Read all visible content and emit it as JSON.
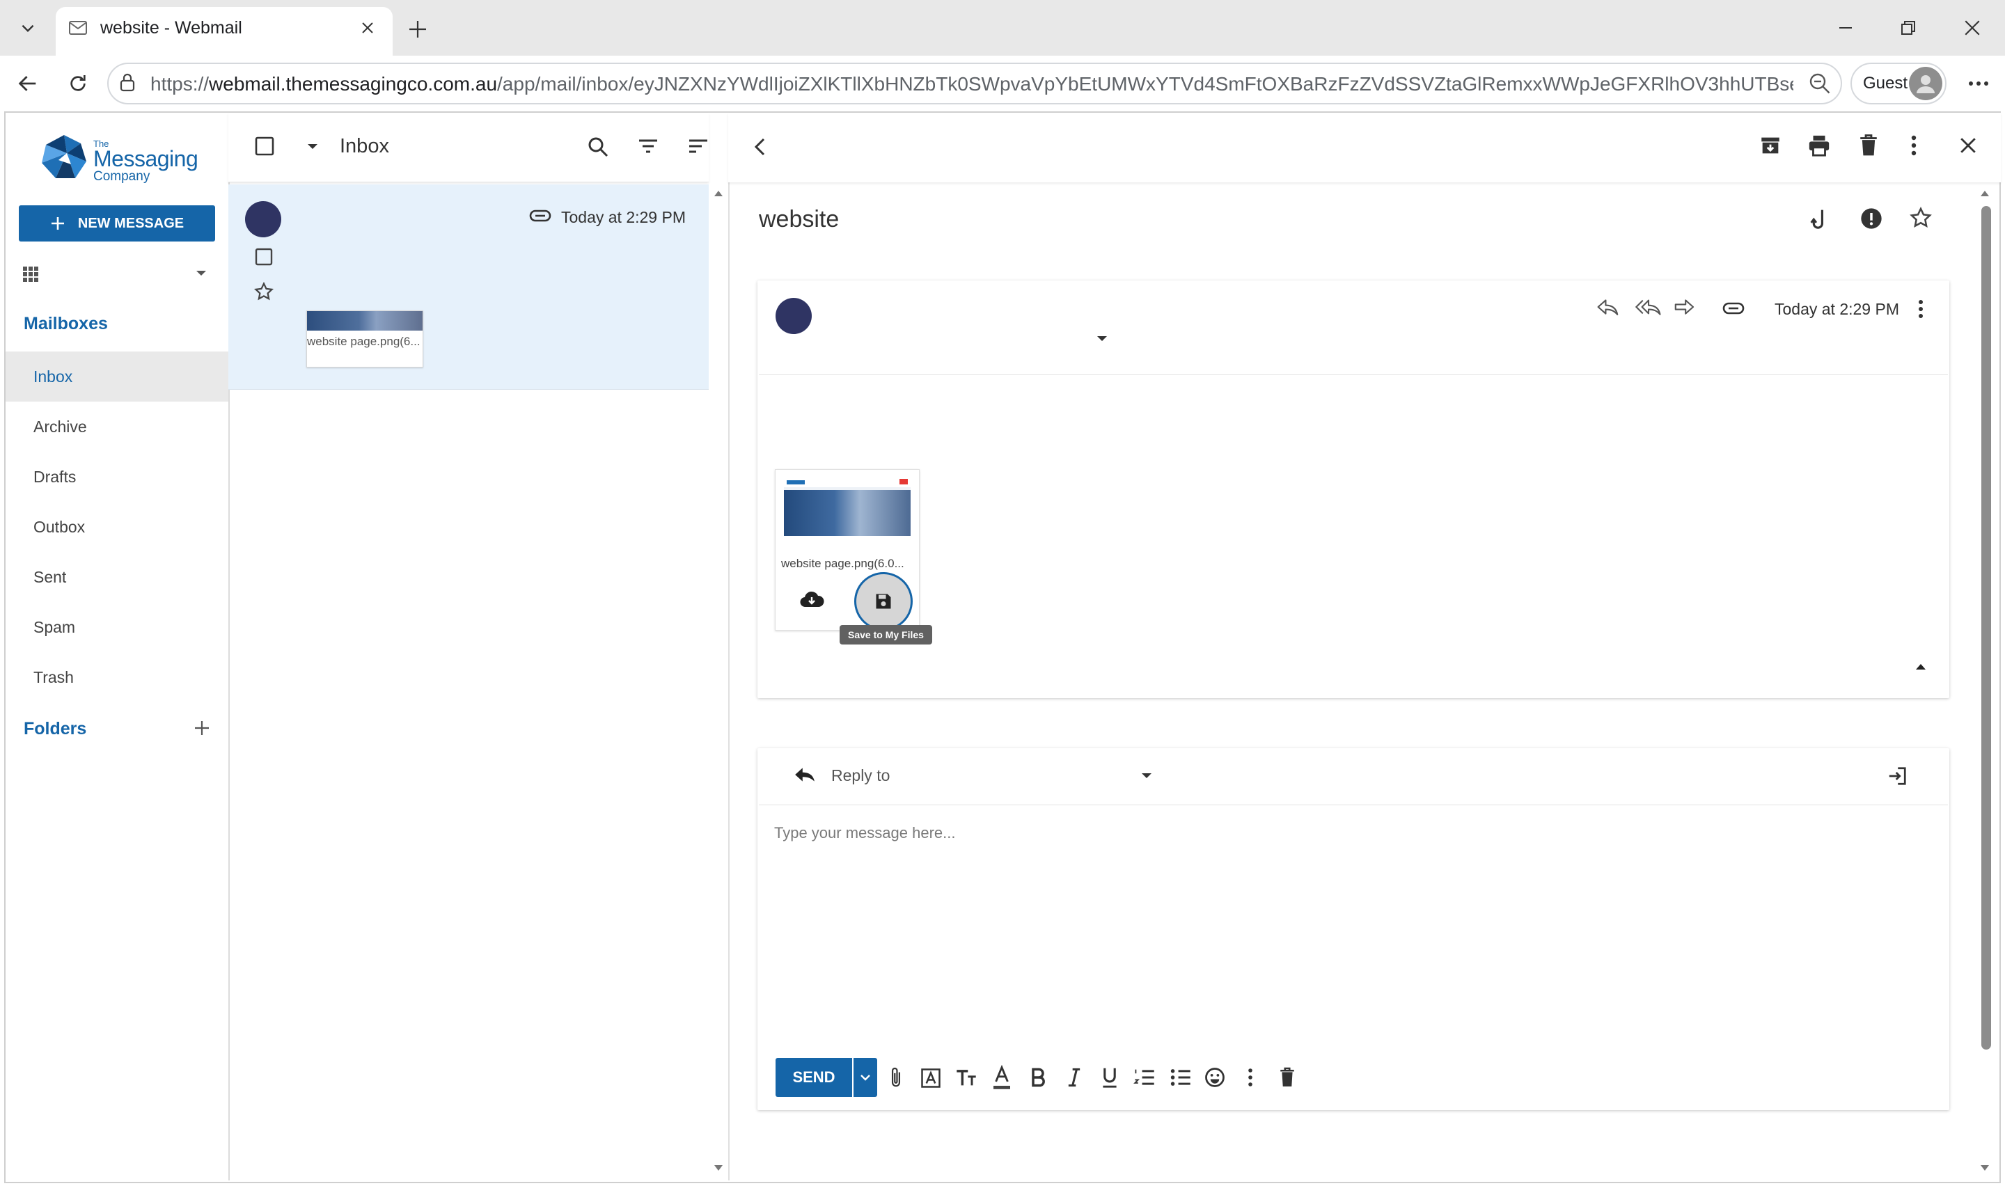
{
  "browser": {
    "tab_title": "website - Webmail",
    "url_prefix": "https://",
    "url_host": "webmail.themessagingco.com.au",
    "url_path": "/app/mail/inbox/eyJNZXNzYWdlIjoiZXlKTllXbHNZbTk0SWpvaVpYbEtUMWxYTVd4SmFtOXBaRzFzZVdSSVZtaGlRemxxWWpJeGFXRlhOV3hhUTBseINXd...",
    "profile_label": "Guest"
  },
  "brand": {
    "line1": "The",
    "line2": "Messaging",
    "line3": "Company"
  },
  "sidebar": {
    "new_message_label": "NEW MESSAGE",
    "mailboxes_heading": "Mailboxes",
    "items": [
      {
        "label": "Inbox",
        "active": true
      },
      {
        "label": "Archive"
      },
      {
        "label": "Drafts"
      },
      {
        "label": "Outbox"
      },
      {
        "label": "Sent"
      },
      {
        "label": "Spam"
      },
      {
        "label": "Trash"
      }
    ],
    "folders_heading": "Folders"
  },
  "list": {
    "title": "Inbox",
    "messages": [
      {
        "time": "Today at 2:29 PM",
        "attachment_name": "website page.png(6..."
      }
    ]
  },
  "reader": {
    "subject": "website",
    "time": "Today at 2:29 PM",
    "attachment_name": "website page.png(6.0...",
    "tooltip": "Save to My Files"
  },
  "reply": {
    "mode_label": "Reply to",
    "body_placeholder": "Type your message here...",
    "send_label": "SEND"
  },
  "colors": {
    "brand_blue": "#1565a8",
    "avatar": "#2f3463",
    "selected_row": "#e6f1fb"
  }
}
